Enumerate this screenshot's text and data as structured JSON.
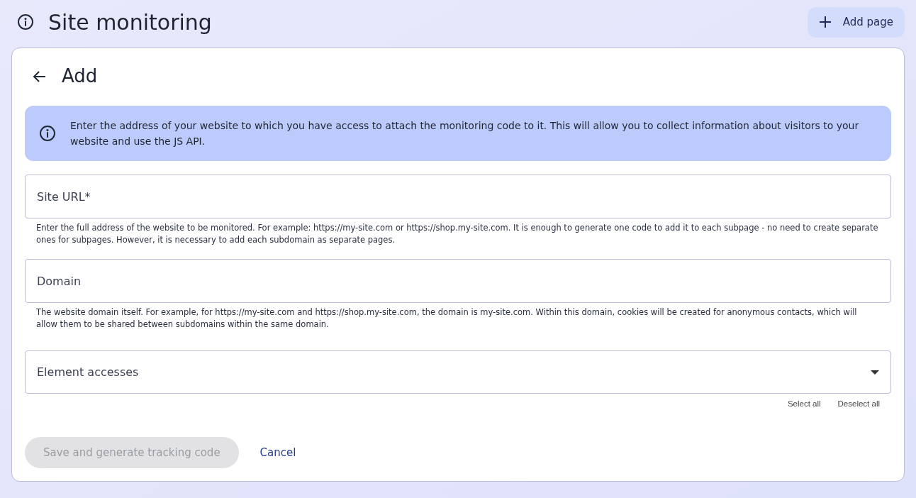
{
  "header": {
    "title": "Site monitoring",
    "add_button": "Add page"
  },
  "card": {
    "title": "Add",
    "notice": "Enter the address of your website to which you have access to attach the monitoring code to it. This will allow you to collect information about visitors to your website and use the JS API.",
    "fields": [
      {
        "kind": "text",
        "placeholder": "Site URL*",
        "help": "Enter the full address of the website to be monitored. For example: https://my-site.com or https://shop.my-site.com. It is enough to generate one code to add it to each subpage - no need to create separate ones for subpages. However, it is necessary to add each subdomain as separate pages."
      },
      {
        "kind": "text",
        "placeholder": "Domain",
        "help": "The website domain itself. For example, for https://my-site.com and https://shop.my-site.com, the domain is my-site.com. Within this domain, cookies will be created for anonymous contacts, which will allow them to be shared between subdomains within the same domain."
      },
      {
        "kind": "select",
        "placeholder": "Element accesses",
        "actions": [
          "Select all",
          "Deselect all"
        ]
      }
    ],
    "save_button": {
      "label": "Save and generate tracking code",
      "disabled": true
    },
    "cancel_link": "Cancel"
  }
}
